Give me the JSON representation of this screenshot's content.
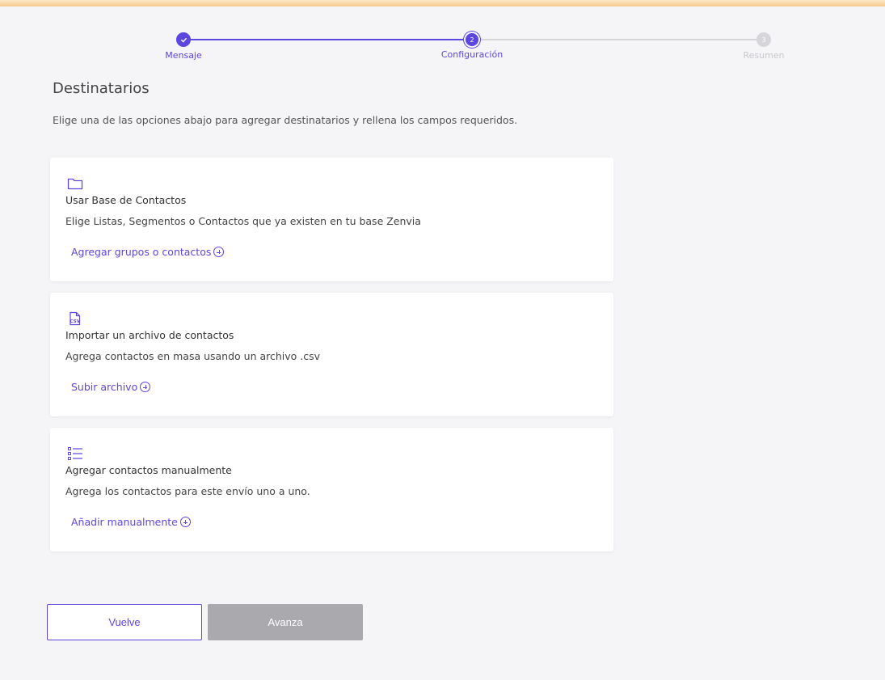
{
  "stepper": {
    "steps": [
      {
        "label": "Mensaje",
        "number": "1",
        "state": "done"
      },
      {
        "label": "Configuración",
        "number": "2",
        "state": "current"
      },
      {
        "label": "Resumen",
        "number": "3",
        "state": "todo"
      }
    ]
  },
  "page": {
    "title": "Destinatarios",
    "description": "Elige una de las opciones abajo para agregar destinatarios y rellena los campos requeridos."
  },
  "cards": [
    {
      "icon": "folder-icon",
      "title": "Usar Base de Contactos",
      "description": "Elige Listas, Segmentos o Contactos que ya existen en tu base Zenvia",
      "action": "Agregar grupos o contactos"
    },
    {
      "icon": "csv-file-icon",
      "title": "Importar un archivo de contactos",
      "description": "Agrega contactos en masa usando un archivo .csv",
      "action": "Subir archivo"
    },
    {
      "icon": "list-icon",
      "title": "Agregar contactos manualmente",
      "description": "Agrega los contactos para este envío uno a uno.",
      "action": "Añadir manualmente"
    }
  ],
  "buttons": {
    "back": "Vuelve",
    "next": "Avanza"
  },
  "colors": {
    "accent": "#5b46e0",
    "disabled": "#a9a9ae",
    "background": "#f5f5f7"
  }
}
